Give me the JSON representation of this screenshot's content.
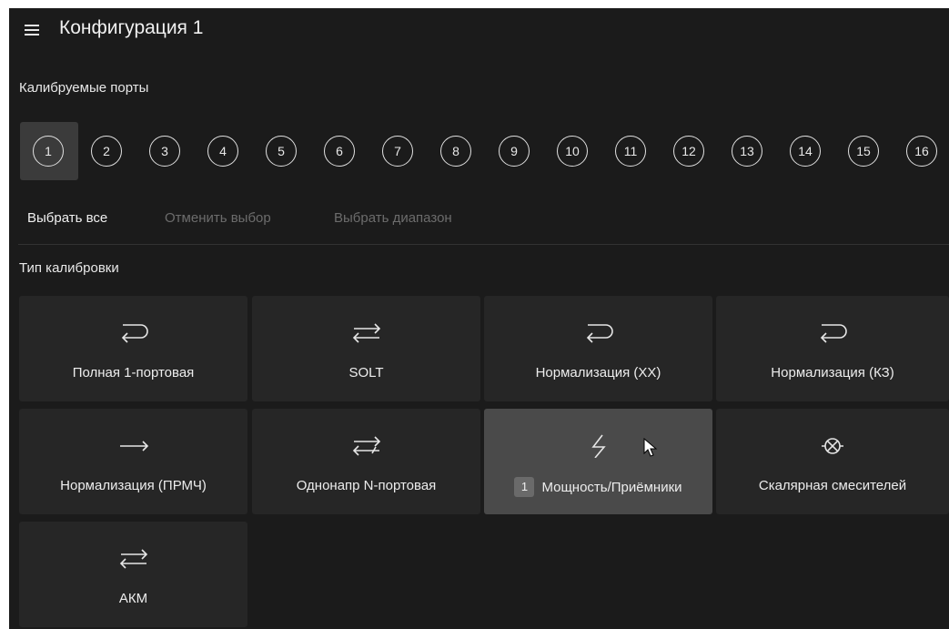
{
  "header": {
    "title": "Конфигурация 1",
    "menu_icon": "hamburger-menu-icon"
  },
  "ports_section": {
    "label": "Калибруемые порты",
    "ports": [
      "1",
      "2",
      "3",
      "4",
      "5",
      "6",
      "7",
      "8",
      "9",
      "10",
      "11",
      "12",
      "13",
      "14",
      "15",
      "16"
    ],
    "selected": "1"
  },
  "actions": {
    "select_all": "Выбрать все",
    "deselect": "Отменить выбор",
    "select_range": "Выбрать диапазон"
  },
  "calibration_section": {
    "label": "Тип калибровки",
    "tiles": [
      {
        "label": "Полная 1-портовая",
        "icon": "loop-arrow-icon"
      },
      {
        "label": "SOLT",
        "icon": "bidirectional-arrows-icon"
      },
      {
        "label": "Нормализация (XX)",
        "icon": "loop-arrow-icon"
      },
      {
        "label": "Нормализация (КЗ)",
        "icon": "loop-arrow-icon"
      },
      {
        "label": "Нормализация (ПРМЧ)",
        "icon": "right-arrow-icon"
      },
      {
        "label": "Однонапр N-портовая",
        "icon": "one-way-multiport-icon"
      },
      {
        "label": "Мощность/Приёмники",
        "icon": "lightning-icon",
        "badge": "1",
        "active": true
      },
      {
        "label": "Скалярная смесителей",
        "icon": "mixer-icon"
      },
      {
        "label": "АКМ",
        "icon": "bidirectional-arrows-icon"
      }
    ]
  },
  "colors": {
    "background": "#1b1b1b",
    "tile": "#262626",
    "tile_active": "#4a4a4a",
    "disabled_text": "#6c6c6c"
  }
}
